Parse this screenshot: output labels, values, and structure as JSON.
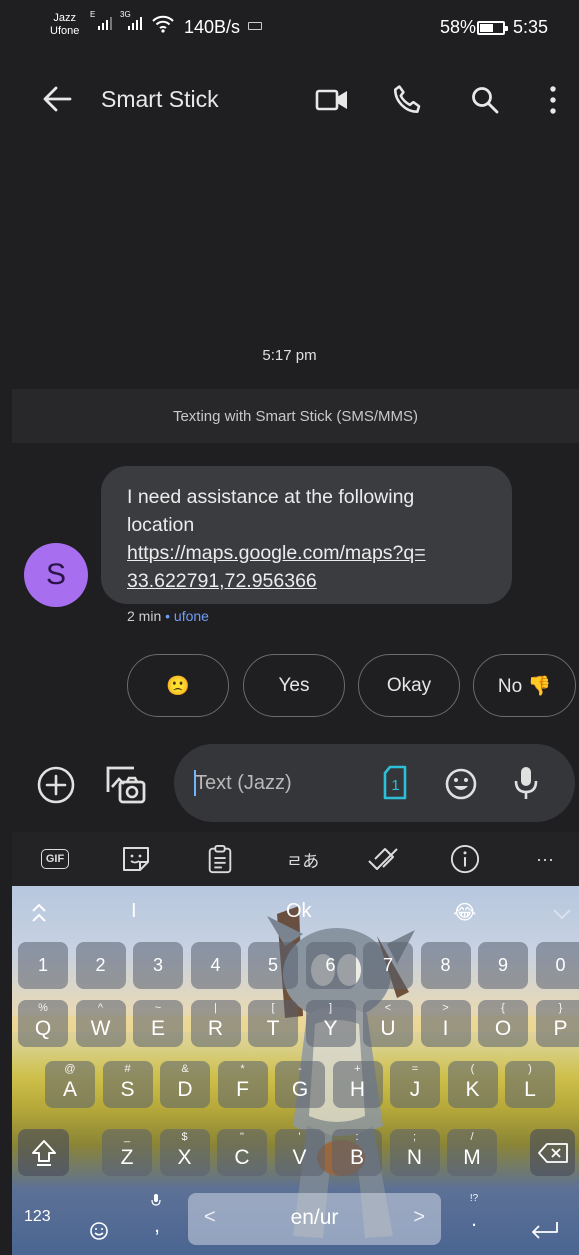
{
  "status_bar": {
    "carrier_1": "Jazz",
    "carrier_2": "Ufone",
    "sim1_net": "E",
    "sim2_net": "3G",
    "net_speed": "140B/s",
    "battery": "58%",
    "battery_level": 0.58,
    "time": "5:35"
  },
  "app_bar": {
    "title": "Smart Stick",
    "icons": [
      "back-arrow-icon",
      "video-call-icon",
      "phone-icon",
      "search-icon",
      "more-vert-icon"
    ]
  },
  "conversation": {
    "timestamp": "5:17 pm",
    "texting_note": "Texting with Smart Stick (SMS/MMS)",
    "avatar_initial": "S",
    "message_line_1": "I need assistance at the following",
    "message_line_2": "location",
    "link_line_1": "https://maps.google.com/maps?q=",
    "link_line_2": "33.622791,72.956366",
    "meta_age": "2 min",
    "meta_sep": " • ",
    "meta_carrier": "ufone"
  },
  "smart_replies": [
    {
      "label": "🙁"
    },
    {
      "label": "Yes"
    },
    {
      "label": "Okay"
    },
    {
      "label": "No 👎"
    }
  ],
  "compose": {
    "placeholder": "Text (Jazz)",
    "sim_number": "1"
  },
  "keyboard_toolbar": {
    "gif": "GIF",
    "more": "···"
  },
  "keyboard": {
    "suggestions": [
      "I",
      "Ok",
      "😂"
    ],
    "numbers": [
      "1",
      "2",
      "3",
      "4",
      "5",
      "6",
      "7",
      "8",
      "9",
      "0"
    ],
    "row1": [
      {
        "k": "Q",
        "a": "%"
      },
      {
        "k": "W",
        "a": "^"
      },
      {
        "k": "E",
        "a": "~"
      },
      {
        "k": "R",
        "a": "|"
      },
      {
        "k": "T",
        "a": "["
      },
      {
        "k": "Y",
        "a": "]"
      },
      {
        "k": "U",
        "a": "<"
      },
      {
        "k": "I",
        "a": ">"
      },
      {
        "k": "O",
        "a": "{"
      },
      {
        "k": "P",
        "a": "}"
      }
    ],
    "row2": [
      {
        "k": "A",
        "a": "@"
      },
      {
        "k": "S",
        "a": "#"
      },
      {
        "k": "D",
        "a": "&"
      },
      {
        "k": "F",
        "a": "*"
      },
      {
        "k": "G",
        "a": "-"
      },
      {
        "k": "H",
        "a": "+"
      },
      {
        "k": "J",
        "a": "="
      },
      {
        "k": "K",
        "a": "("
      },
      {
        "k": "L",
        "a": ")"
      }
    ],
    "row3": [
      {
        "k": "Z",
        "a": "_"
      },
      {
        "k": "X",
        "a": "$"
      },
      {
        "k": "C",
        "a": "\""
      },
      {
        "k": "V",
        "a": "'"
      },
      {
        "k": "B",
        "a": ":"
      },
      {
        "k": "N",
        "a": ";"
      },
      {
        "k": "M",
        "a": "/"
      }
    ],
    "symbols_key": "123",
    "comma": ",",
    "space_label": "en/ur",
    "space_left": "<",
    "space_right": ">",
    "period": ".",
    "period_alt": "!?"
  }
}
